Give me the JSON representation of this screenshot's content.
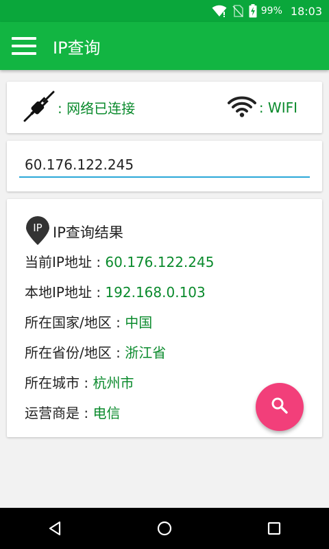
{
  "status_bar": {
    "battery_percent": "99%",
    "time": "18:03"
  },
  "app_bar": {
    "title": "IP查询"
  },
  "network_status": {
    "connection_text": ": 网络已连接",
    "network_type_text": ": WIFI"
  },
  "ip_input": {
    "value": "60.176.122.245"
  },
  "result": {
    "badge_text": "IP",
    "title": "IP查询结果",
    "rows": [
      {
        "label": "当前IP地址 : ",
        "value": "60.176.122.245"
      },
      {
        "label": "本地IP地址 : ",
        "value": "192.168.0.103"
      },
      {
        "label": "所在国家/地区 : ",
        "value": "中国"
      },
      {
        "label": "所在省份/地区 : ",
        "value": "浙江省"
      },
      {
        "label": "所在城市 : ",
        "value": "杭州市"
      },
      {
        "label": "运营商是 : ",
        "value": "电信"
      }
    ]
  },
  "colors": {
    "status_bar": "#0aa73b",
    "app_bar": "#12b542",
    "value_text": "#0a8a2c",
    "fab": "#f23f7a",
    "input_underline": "#2aa7d8"
  },
  "icons": {
    "menu": "hamburger-icon",
    "network": "plug-icon",
    "wifi": "wifi-icon",
    "result_badge": "ip-pin-icon",
    "fab": "search-icon"
  }
}
